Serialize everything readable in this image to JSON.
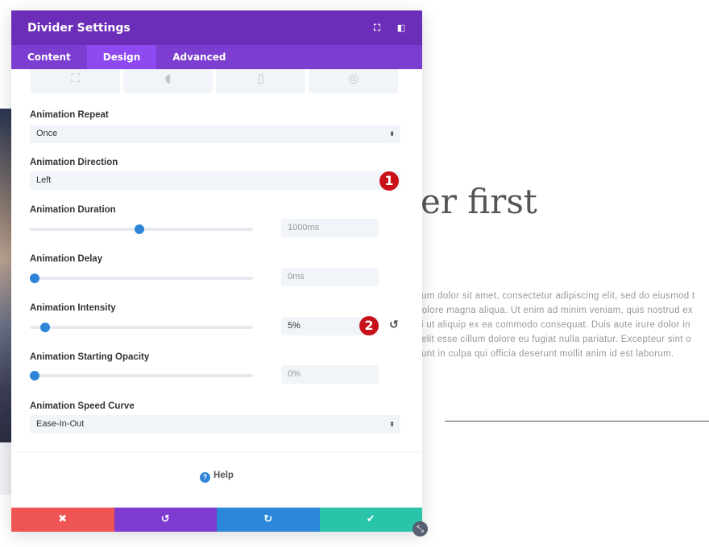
{
  "background": {
    "heading": "er first",
    "body_lines": [
      "sum dolor sit amet, consectetur adipiscing elit, sed do eiusmod t",
      " dolore magna aliqua. Ut enim ad minim veniam, quis nostrud ex",
      "si ut aliquip ex ea commodo consequat. Duis aute irure dolor in",
      " velit esse cillum dolore eu fugiat nulla pariatur. Excepteur sint o",
      " sunt in culpa qui officia deserunt mollit anim id est laborum."
    ]
  },
  "panel": {
    "title": "Divider Settings",
    "header_icons": [
      "fullscreen-icon",
      "sidebar-dock-icon"
    ],
    "tabs": [
      {
        "label": "Content"
      },
      {
        "label": "Design",
        "active": true
      },
      {
        "label": "Advanced"
      }
    ],
    "animation_style_icons": [
      "zoom-icon",
      "fold-icon",
      "flip-icon",
      "roll-icon"
    ],
    "fields": {
      "repeat": {
        "label": "Animation Repeat",
        "value": "Once"
      },
      "direction": {
        "label": "Animation Direction",
        "value": "Left",
        "badge": "1"
      },
      "duration": {
        "label": "Animation Duration",
        "value": "1000ms",
        "slider_fraction": 0.49
      },
      "delay": {
        "label": "Animation Delay",
        "value": "0ms",
        "slider_fraction": 0
      },
      "intensity": {
        "label": "Animation Intensity",
        "value": "5%",
        "slider_fraction": 0.05,
        "badge": "2"
      },
      "opacity": {
        "label": "Animation Starting Opacity",
        "value": "0%",
        "slider_fraction": 0
      },
      "speed_curve": {
        "label": "Animation Speed Curve",
        "value": "Ease-In-Out"
      }
    },
    "help_label": "Help",
    "footer": {
      "cancel_color": "#ef5555",
      "undo_color": "#7e3bd0",
      "redo_color": "#2b87da",
      "save_color": "#29c4a9"
    }
  }
}
